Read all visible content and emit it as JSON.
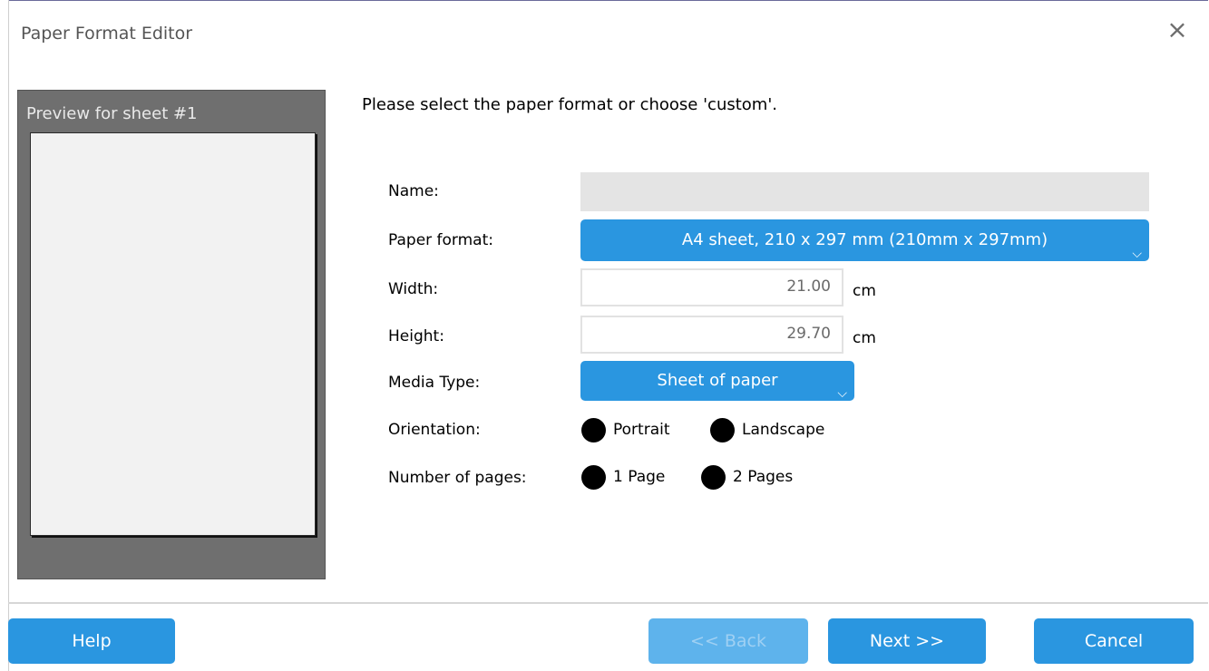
{
  "window": {
    "title": "Paper Format Editor"
  },
  "preview": {
    "label": "Preview for sheet #1"
  },
  "instruction": "Please select the paper format or choose 'custom'.",
  "form": {
    "name_label": "Name:",
    "name_value": "",
    "paper_format_label": "Paper format:",
    "paper_format_value": "A4 sheet, 210 x 297 mm (210mm x 297mm)",
    "width_label": "Width:",
    "width_value": "21.00",
    "width_unit": "cm",
    "height_label": "Height:",
    "height_value": "29.70",
    "height_unit": "cm",
    "media_type_label": "Media Type:",
    "media_type_value": "Sheet of paper",
    "orientation_label": "Orientation:",
    "orientation_options": [
      "Portrait",
      "Landscape"
    ],
    "pages_label": "Number of pages:",
    "pages_options": [
      "1 Page",
      "2 Pages"
    ]
  },
  "buttons": {
    "help": "Help",
    "back": "<< Back",
    "next": "Next >>",
    "cancel": "Cancel"
  },
  "colors": {
    "accent": "#2a96e0",
    "accent_disabled": "#5eb3ec",
    "preview_bg": "#6f6f6f",
    "name_field_bg": "#e4e4e4"
  },
  "icons": {
    "close": "close-icon",
    "dropdown": "chevron-down-icon"
  }
}
